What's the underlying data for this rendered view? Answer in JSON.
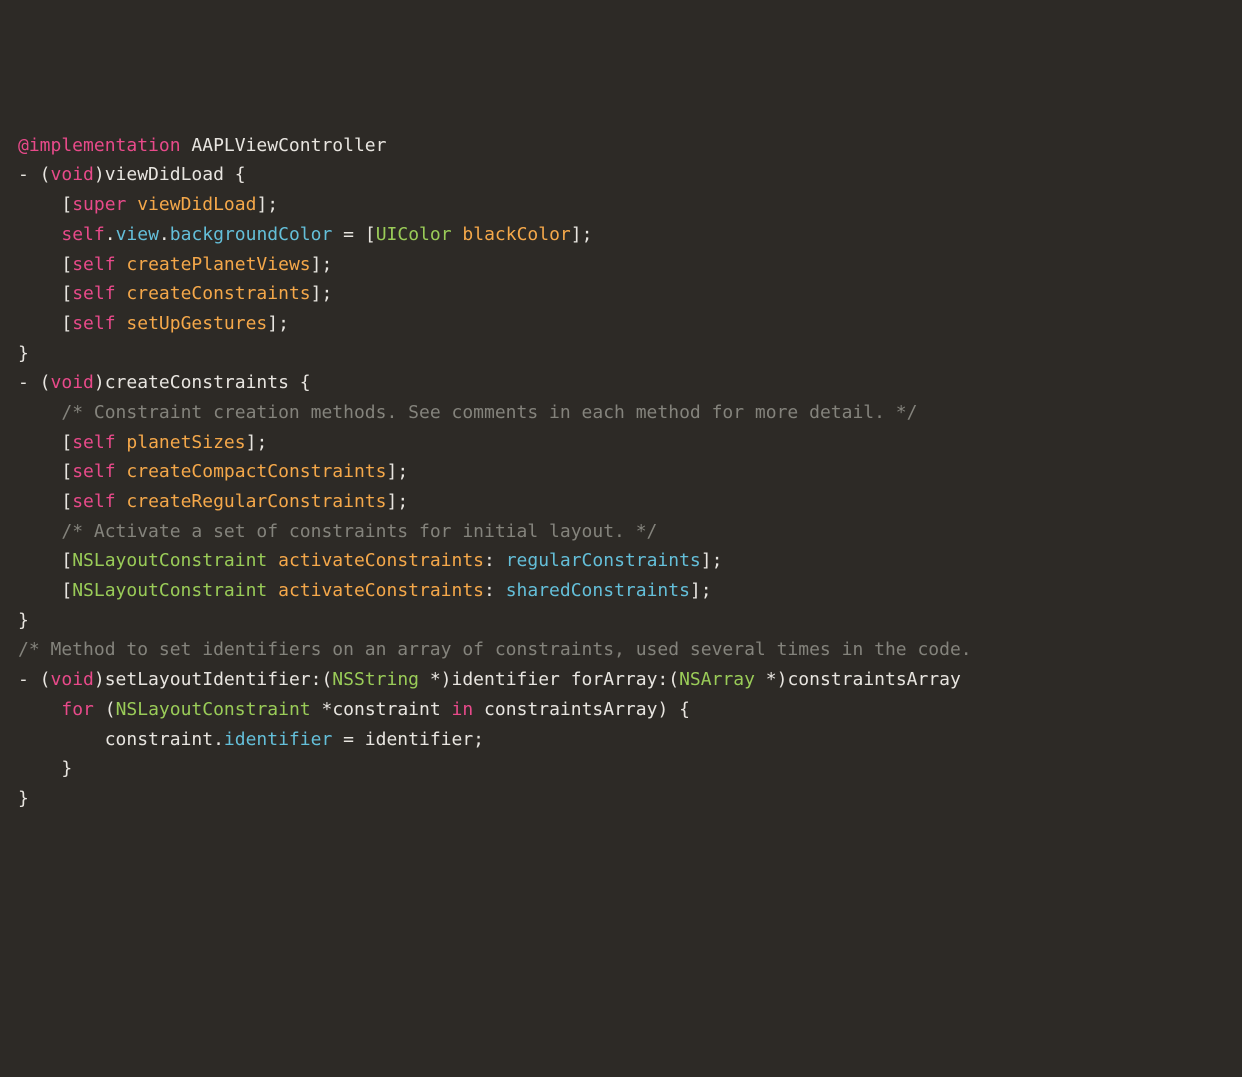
{
  "code": {
    "line1": {
      "impl": "@implementation",
      "cls": " AAPLViewController"
    },
    "blank1": "",
    "line3": {
      "dash": "- (",
      "void": "void",
      "sig": ")viewDidLoad {"
    },
    "line4": {
      "indent": "    [",
      "super": "super",
      "sp": " ",
      "method": "viewDidLoad",
      "end": "];"
    },
    "blank2": "",
    "line6": {
      "indent": "    ",
      "self": "self",
      "dot1": ".",
      "view": "view",
      "dot2": ".",
      "bg": "backgroundColor",
      "eq": " = [",
      "uicolor": "UIColor",
      "sp": " ",
      "black": "blackColor",
      "end": "];"
    },
    "blank3": "",
    "line8": {
      "indent": "    [",
      "self": "self",
      "sp": " ",
      "method": "createPlanetViews",
      "end": "];"
    },
    "blank4": "",
    "line10": {
      "indent": "    [",
      "self": "self",
      "sp": " ",
      "method": "createConstraints",
      "end": "];"
    },
    "blank5": "",
    "line12": {
      "indent": "    [",
      "self": "self",
      "sp": " ",
      "method": "setUpGestures",
      "end": "];"
    },
    "line13": "}",
    "blank6": "",
    "line15": {
      "dash": "- (",
      "void": "void",
      "sig": ")createConstraints {"
    },
    "line16": {
      "indent": "    ",
      "comment": "/* Constraint creation methods. See comments in each method for more detail. */"
    },
    "line17": {
      "indent": "    [",
      "self": "self",
      "sp": " ",
      "method": "planetSizes",
      "end": "];"
    },
    "blank7": "",
    "line19": {
      "indent": "    [",
      "self": "self",
      "sp": " ",
      "method": "createCompactConstraints",
      "end": "];"
    },
    "blank8": "",
    "line21": {
      "indent": "    [",
      "self": "self",
      "sp": " ",
      "method": "createRegularConstraints",
      "end": "];"
    },
    "blank9": "",
    "line23": {
      "indent": "    ",
      "comment": "/* Activate a set of constraints for initial layout. */"
    },
    "line24": {
      "indent": "    [",
      "cls": "NSLayoutConstraint",
      "sp": " ",
      "method": "activateConstraints",
      "colon": ": ",
      "arg": "regularConstraints",
      "end": "];"
    },
    "line25": {
      "indent": "    [",
      "cls": "NSLayoutConstraint",
      "sp": " ",
      "method": "activateConstraints",
      "colon": ": ",
      "arg": "sharedConstraints",
      "end": "];"
    },
    "line26": "}",
    "blank10": "",
    "line28": {
      "comment": "/* Method to set identifiers on an array of constraints, used several times in the code."
    },
    "line29": {
      "dash": "- (",
      "void": "void",
      "p1": ")setLayoutIdentifier:(",
      "nsstring": "NSString",
      "p2": " *)identifier forArray:(",
      "nsarray": "NSArray",
      "p3": " *)constraintsArray"
    },
    "line30": {
      "indent": "    ",
      "for": "for",
      "p1": " (",
      "cls": "NSLayoutConstraint",
      "p2": " *constraint ",
      "in": "in",
      "p3": " constraintsArray) {"
    },
    "line31": {
      "indent": "        constraint.",
      "prop": "identifier",
      "rest": " = identifier;"
    },
    "line32": "    }",
    "line33": "}"
  }
}
